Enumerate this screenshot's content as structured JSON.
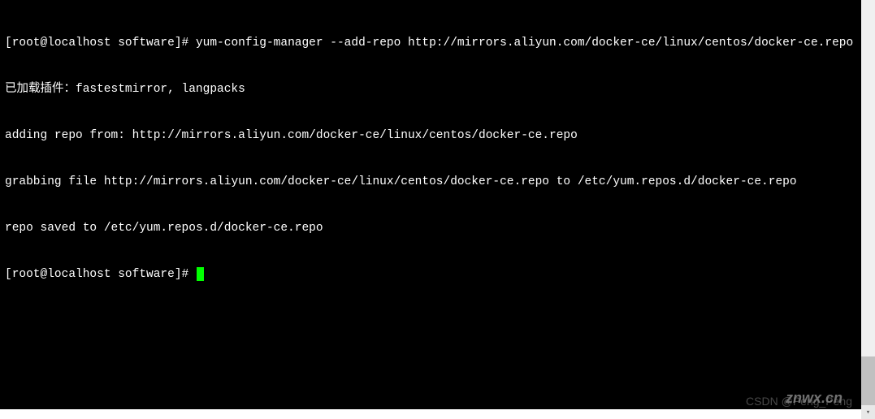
{
  "terminal": {
    "lines": [
      {
        "prompt": "[root@localhost software]# ",
        "cmd": "yum-config-manager --add-repo http://mirrors.aliyun.com/docker-ce/linux/centos/docker-ce.repo"
      },
      {
        "text": "已加载插件：fastestmirror, langpacks"
      },
      {
        "text": "adding repo from: http://mirrors.aliyun.com/docker-ce/linux/centos/docker-ce.repo"
      },
      {
        "text": "grabbing file http://mirrors.aliyun.com/docker-ce/linux/centos/docker-ce.repo to /etc/yum.repos.d/docker-ce.repo"
      },
      {
        "text": "repo saved to /etc/yum.repos.d/docker-ce.repo"
      },
      {
        "prompt": "[root@localhost software]# ",
        "cursor": true
      }
    ]
  },
  "watermarks": {
    "w1": "znwx.cn",
    "w2": "CSDN @Peng_Peng"
  },
  "scroll": {
    "down_glyph": "▾"
  }
}
